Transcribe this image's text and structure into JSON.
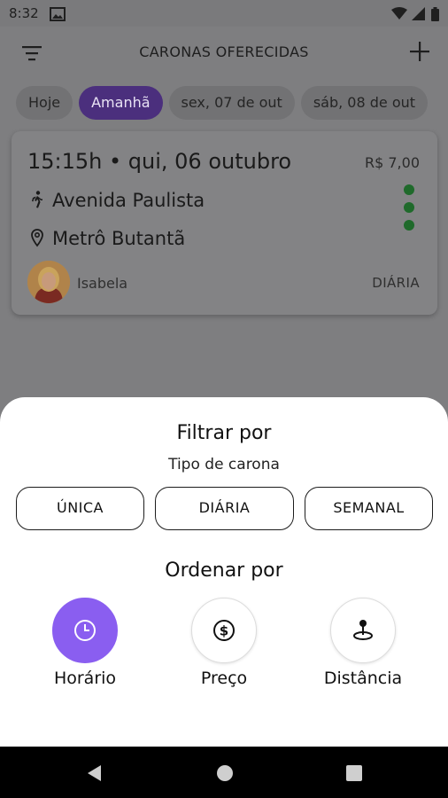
{
  "status_bar": {
    "time": "8:32"
  },
  "app_bar": {
    "title": "CARONAS OFERECIDAS"
  },
  "date_chips": [
    {
      "label": "Hoje",
      "selected": false
    },
    {
      "label": "Amanhã",
      "selected": true
    },
    {
      "label": "sex, 07 de out",
      "selected": false
    },
    {
      "label": "sáb, 08 de out",
      "selected": false
    }
  ],
  "ride_card": {
    "heading": "15:15h • qui, 06 outubro",
    "price": "R$ 7,00",
    "origin": "Avenida Paulista",
    "destination": "Metrô Butantã",
    "driver_name": "Isabela",
    "frequency": "DIÁRIA"
  },
  "filter_sheet": {
    "filter_title": "Filtrar por",
    "filter_subtitle": "Tipo de carona",
    "ride_types": [
      "ÚNICA",
      "DIÁRIA",
      "SEMANAL"
    ],
    "sort_title": "Ordenar por",
    "sort_options": [
      {
        "label": "Horário",
        "icon": "clock-icon",
        "selected": true
      },
      {
        "label": "Preço",
        "icon": "dollar-icon",
        "selected": false
      },
      {
        "label": "Distância",
        "icon": "location-pin-icon",
        "selected": false
      }
    ]
  },
  "colors": {
    "accent": "#8a5ef0",
    "status_dot": "#2e9c40",
    "scrim_background": "#7e7e80"
  }
}
